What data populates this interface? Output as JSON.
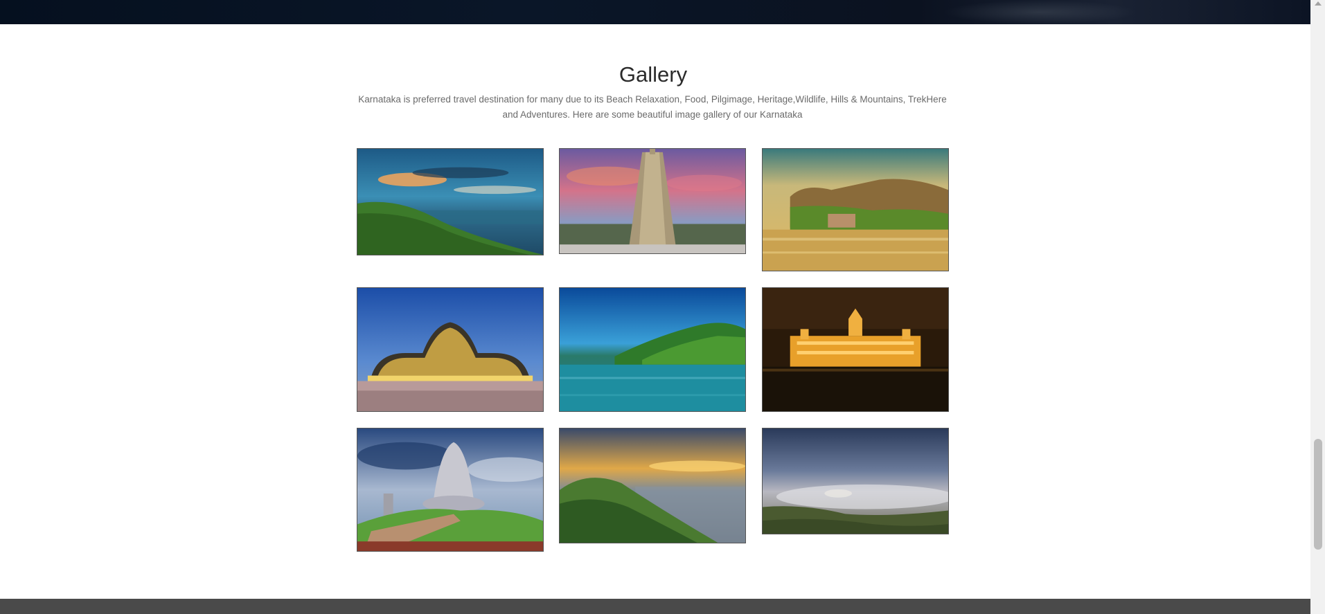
{
  "gallery": {
    "title": "Gallery",
    "description": "Karnataka is preferred travel destination for many due to its Beach Relaxation, Food, Pilgimage, Heritage,Wildlife, Hills & Mountains, TrekHere and Adventures. Here are some beautiful image gallery of our Karnataka"
  },
  "colors": {
    "top_band": "#0a1628",
    "footer_band": "#4a4a4a",
    "title_text": "#2b2b2b",
    "desc_text": "#6a6a6a"
  }
}
